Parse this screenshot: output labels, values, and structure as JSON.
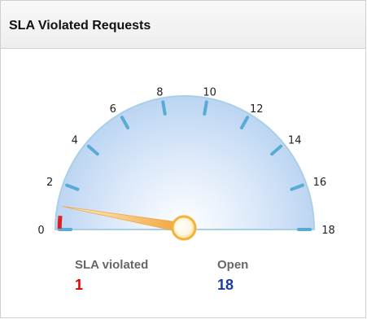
{
  "widget": {
    "title": "SLA Violated Requests"
  },
  "gauge": {
    "min": 0,
    "max": 18,
    "value": 1,
    "tick_labels": [
      "0",
      "2",
      "4",
      "6",
      "8",
      "10",
      "12",
      "14",
      "16",
      "18"
    ],
    "colors": {
      "scale_edge": "#a9d0e6",
      "tick": "#5aaad6",
      "violation_band": "#e02020",
      "needle": "#f2a640",
      "hub": "#f5b23a"
    }
  },
  "stats": {
    "sla_violated": {
      "label": "SLA violated",
      "value": "1",
      "color": "#e00000"
    },
    "open": {
      "label": "Open",
      "value": "18",
      "color": "#1a3aa8"
    }
  }
}
